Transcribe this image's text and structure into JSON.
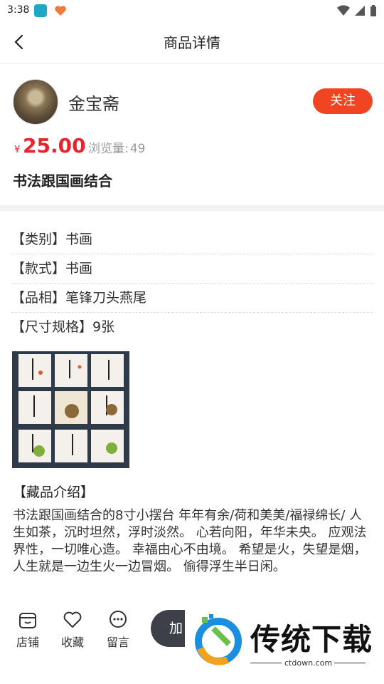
{
  "status_bar": {
    "time": "3:38"
  },
  "header": {
    "title": "商品详情"
  },
  "seller": {
    "name": "金宝斋",
    "follow_label": "关注"
  },
  "product": {
    "currency_symbol": "¥",
    "price": "25.00",
    "views_label": "浏览量:",
    "views_count": "49",
    "title": "书法跟国画结合"
  },
  "attributes": [
    {
      "label": "【类别】",
      "value": "书画"
    },
    {
      "label": "【款式】",
      "value": "书画"
    },
    {
      "label": "【品相】",
      "value": "笔锋刀头燕尾"
    },
    {
      "label": "【尺寸规格】",
      "value": "9张"
    }
  ],
  "intro": {
    "heading": "【藏品介绍】",
    "text": "书法跟国画结合的8寸小摆台 年年有余/荷和美美/福禄绵长/ 人生如茶，沉时坦然，浮时淡然。 心若向阳，年华未央。 应观法界性，一切唯心造。 幸福由心不由境。 希望是火，失望是烟，人生就是一边生火一边冒烟。 偷得浮生半日闲。"
  },
  "bottom_bar": {
    "shop_label": "店铺",
    "favorite_label": "收藏",
    "message_label": "留言",
    "cart_label": "加"
  },
  "watermark": {
    "title": "传统下载",
    "url": "ctdown.com"
  },
  "colors": {
    "accent": "#f04422",
    "price": "#e8232b",
    "cart_button": "#3e4049"
  }
}
